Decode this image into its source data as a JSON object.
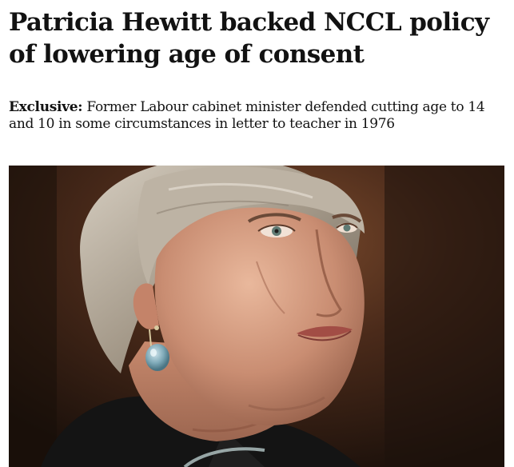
{
  "article": {
    "headline": "Patricia Hewitt backed NCCL policy of lowering age of consent",
    "standfirst_kicker": "Exclusive:",
    "standfirst_text": "Former Labour cabinet minister defended cutting age to 14 and 10 in some circumstances in letter to teacher in 1976"
  },
  "image": {
    "subject": "portrait-photo-woman"
  },
  "colors": {
    "text": "#121212",
    "background": "#ffffff"
  }
}
